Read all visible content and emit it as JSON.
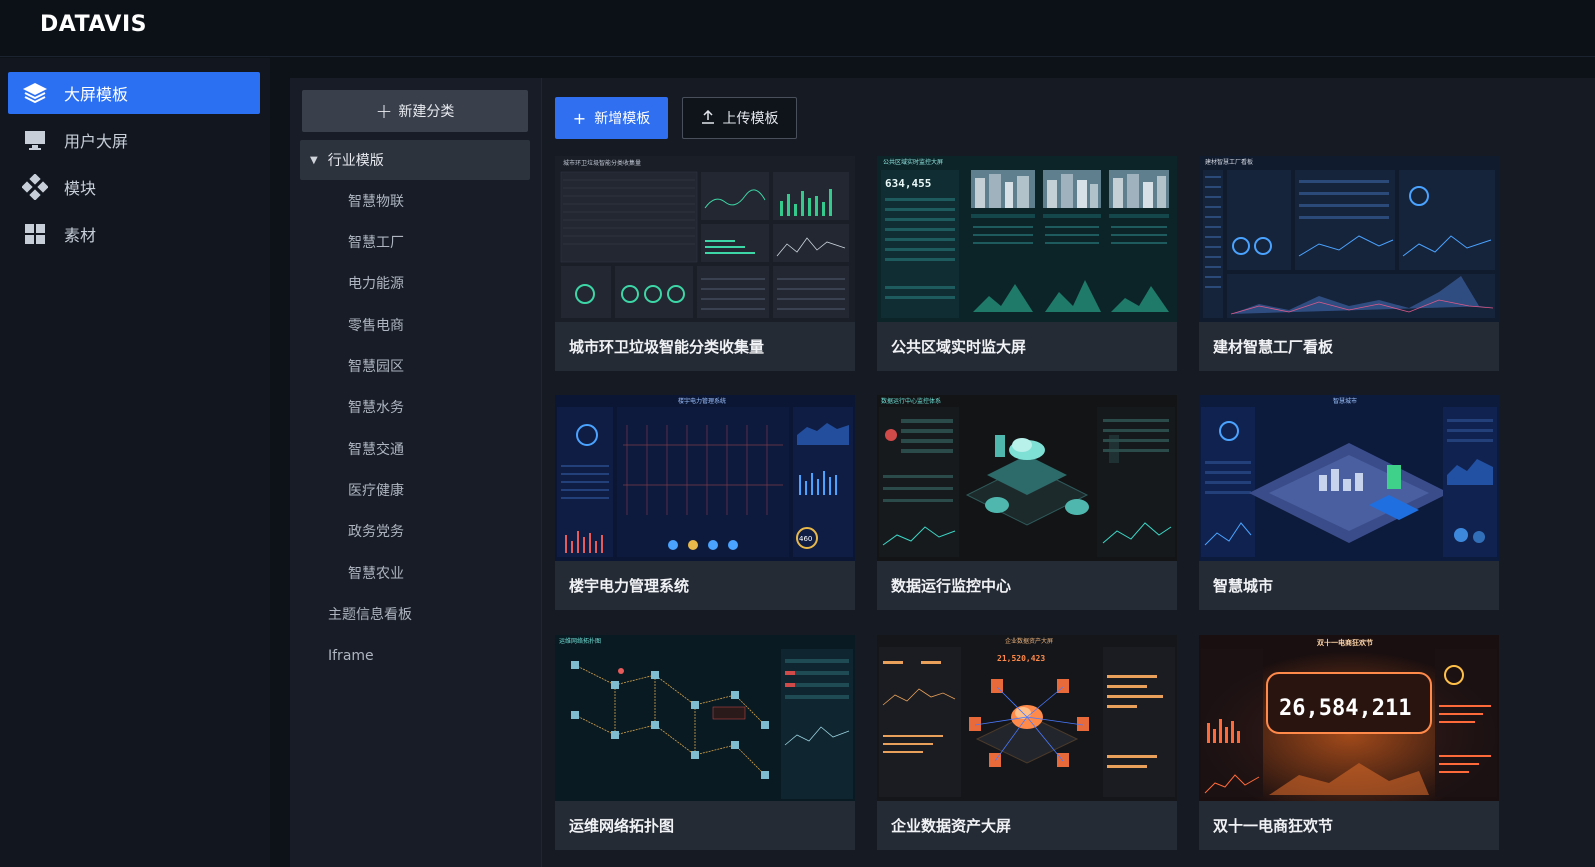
{
  "app": {
    "logo": "DATAVIS"
  },
  "nav": {
    "items": [
      {
        "label": "大屏模板",
        "icon": "layers-icon",
        "active": true
      },
      {
        "label": "用户大屏",
        "icon": "monitor-icon",
        "active": false
      },
      {
        "label": "模块",
        "icon": "module-icon",
        "active": false
      },
      {
        "label": "素材",
        "icon": "grid-icon",
        "active": false
      }
    ]
  },
  "categories": {
    "new_label": "新建分类",
    "group_label": "行业模版",
    "sub_items": [
      "智慧物联",
      "智慧工厂",
      "电力能源",
      "零售电商",
      "智慧园区",
      "智慧水务",
      "智慧交通",
      "医疗健康",
      "政务党务",
      "智慧农业"
    ],
    "top_items": [
      "主题信息看板",
      "Iframe"
    ]
  },
  "toolbar": {
    "add_label": "新增模板",
    "upload_label": "上传模板"
  },
  "templates": [
    {
      "title": "城市环卫垃圾智能分类收集量",
      "thumb_title": "城市环卫垃圾智能分类收集量"
    },
    {
      "title": "公共区域实时监大屏",
      "thumb_title": "公共区域实时监控大屏",
      "thumb_number": "634,455"
    },
    {
      "title": "建材智慧工厂看板",
      "thumb_title": "建材智慧工厂看板"
    },
    {
      "title": "楼宇电力管理系统",
      "thumb_title": "楼宇电力管理系统",
      "thumb_number": "460"
    },
    {
      "title": "数据运行监控中心",
      "thumb_title": "数据运行中心监控体系"
    },
    {
      "title": "智慧城市",
      "thumb_title": "智慧城市"
    },
    {
      "title": "运维网络拓扑图",
      "thumb_title": "运维网络拓扑图"
    },
    {
      "title": "企业数据资产大屏",
      "thumb_title": "企业数据资产大屏",
      "thumb_number": "21,520,423"
    },
    {
      "title": "双十一电商狂欢节",
      "thumb_title": "双十一电商狂欢节",
      "thumb_number": "26,584,211"
    }
  ],
  "colors": {
    "accent": "#2f6ff0",
    "bg": "#0d1118",
    "card": "#252b35"
  }
}
